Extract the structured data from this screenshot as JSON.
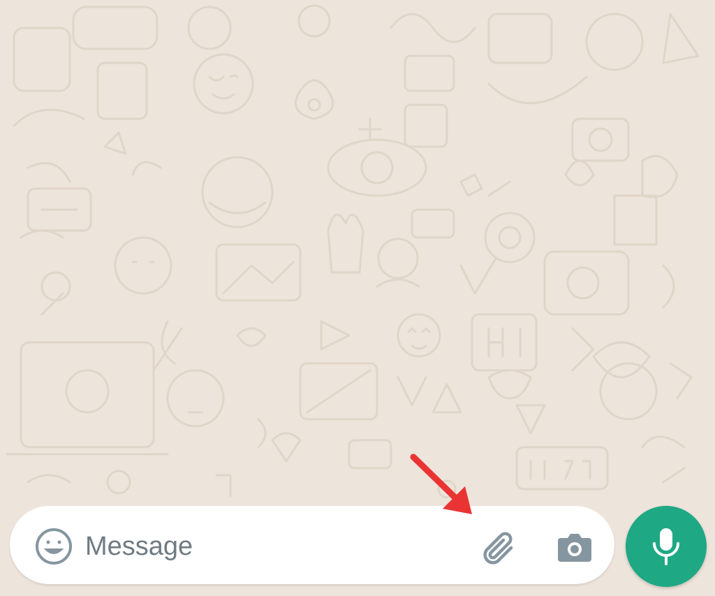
{
  "composer": {
    "placeholder": "Message",
    "value": ""
  },
  "icons": {
    "emoji": "emoji-icon",
    "attach": "paperclip-icon",
    "camera": "camera-icon",
    "mic": "microphone-icon",
    "annotation": "red-arrow-icon"
  },
  "colors": {
    "background": "#ede4db",
    "doodle": "#e2d7cb",
    "bar": "#ffffff",
    "icon_gray": "#8696a0",
    "send_green": "#1fa884",
    "arrow_red": "#ea3434"
  }
}
